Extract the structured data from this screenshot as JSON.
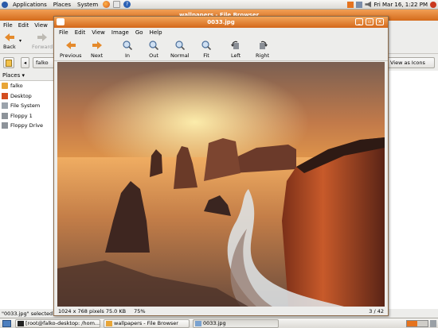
{
  "top_panel": {
    "menus": [
      "Applications",
      "Places",
      "System"
    ],
    "clock": "Fri Mar 16,  1:22 PM"
  },
  "file_browser": {
    "title": "wallpapers - File Browser",
    "menus": [
      "File",
      "Edit",
      "View",
      "G"
    ],
    "toolbar": {
      "back": "Back",
      "forward": "Forward"
    },
    "location": "falko",
    "view_as": "View as Icons",
    "sidebar": {
      "header": "Places",
      "items": [
        "falko",
        "Desktop",
        "File System",
        "Floppy 1",
        "Floppy Drive"
      ]
    },
    "status": "\"0033.jpg\" selected (7"
  },
  "viewer": {
    "title": "0033.jpg",
    "menus": [
      "File",
      "Edit",
      "View",
      "Image",
      "Go",
      "Help"
    ],
    "toolbar": {
      "previous": "Previous",
      "next": "Next",
      "zoom_in": "In",
      "zoom_out": "Out",
      "normal": "Normal",
      "fit": "Fit",
      "rotate_left": "Left",
      "rotate_right": "Right"
    },
    "status": {
      "dimensions": "1024 x 768 pixels  75.0 KB",
      "zoom": "75%",
      "position": "3 / 42"
    }
  },
  "taskbar": {
    "tasks": [
      "[root@falko-desktop: /hom...",
      "wallpapers - File Browser",
      "0033.jpg"
    ]
  },
  "colors": {
    "titlebar": "#d46a1b",
    "panel": "#dcdad5"
  }
}
